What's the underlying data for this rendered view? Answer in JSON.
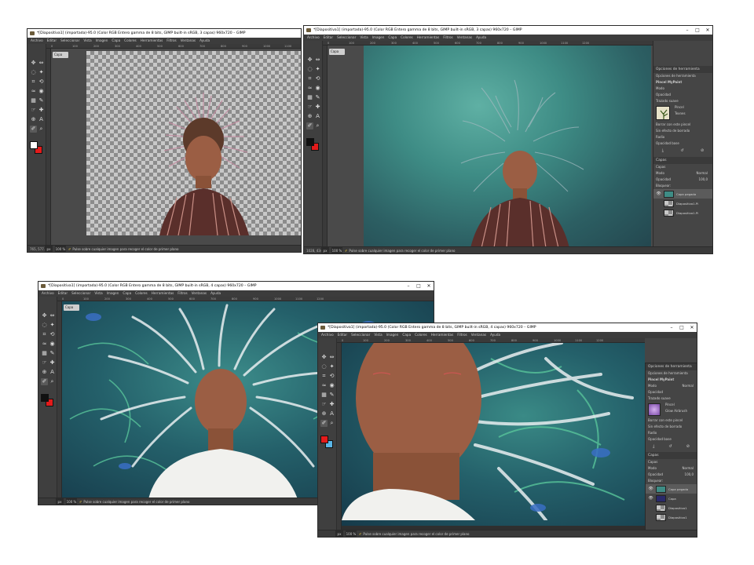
{
  "windows": [
    {
      "title": "*[Diapositiva1] (importada)-95.0 (Color RGB Entero gamma de 8 bits, GIMP built-in sRGB, 3 capas) 960x720 – GIMP",
      "status_coords": "765, 577.0",
      "layer_button": "Capa",
      "variant": "transparent",
      "has_controls": false
    },
    {
      "title": "*[Diapositiva1] (importada)-95.0 (Color RGB Entero gamma de 8 bits, GIMP built-in sRGB, 3 capas) 960x720 – GIMP",
      "status_coords": "1028, 434.0",
      "layer_button": "Capa",
      "variant": "teal-dark",
      "has_controls": true
    },
    {
      "title": "*[Diapositiva1] (importada)-95.0 (Color RGB Entero gamma de 8 bits, GIMP built-in sRGB, 4 capas) 960x720 – GIMP",
      "status_coords": "",
      "layer_button": "Capa",
      "variant": "painted",
      "has_controls": true
    },
    {
      "title": "*[Diapositiva1] (importada)-95.0 (Color RGB Entero gamma de 8 bits, GIMP built-in sRGB, 4 capas) 960x720 – GIMP",
      "status_coords": "",
      "layer_button": "",
      "variant": "zoomed",
      "has_controls": true
    }
  ],
  "menu": [
    "Archivo",
    "Editar",
    "Seleccionar",
    "Vista",
    "Imagen",
    "Capa",
    "Colores",
    "Herramientas",
    "Filtros",
    "Ventanas",
    "Ayuda"
  ],
  "statusbar": {
    "unit": "px",
    "zoom": "100 %",
    "message": "Pulse sobre cualquier imagen para recoger el color de primer plano"
  },
  "window_controls": {
    "minimize": "–",
    "maximize": "□",
    "close": "✕"
  },
  "ruler_ticks": [
    "0",
    "100",
    "200",
    "300",
    "400",
    "500",
    "600",
    "700",
    "800",
    "900",
    "1000",
    "1100",
    "1200"
  ],
  "tool_icons": [
    "move-icon",
    "align-icon",
    "lasso-icon",
    "fuzzy-select-icon",
    "crop-icon",
    "transform-icon",
    "warp-icon",
    "bucket-fill-icon",
    "gradient-icon",
    "paintbrush-icon",
    "smudge-icon",
    "heal-icon",
    "clone-icon",
    "text-icon",
    "color-picker-icon",
    "zoom-icon"
  ],
  "tool_glyphs": [
    "✥",
    "⇔",
    "◌",
    "✦",
    "⌗",
    "⟲",
    "≈",
    "◉",
    "▦",
    "✎",
    "☞",
    "✚",
    "⊕",
    "A",
    "✐",
    "⌕"
  ],
  "tool_options_b": {
    "header": "Opciones de herramienta",
    "tab": "Opciones de herramienta",
    "tool": "Pincel MyPaint",
    "mode_label": "Modo",
    "mode_value": "Normal",
    "opacity": "Opacidad",
    "smooth": "Trazado suave",
    "brush_label": "Pincel",
    "brush_name": "Texnes",
    "erase": "Borrar con este pincel",
    "no_erase": "Sin efecto de borrado",
    "radius": "Radio",
    "base_opacity": "Opacidad base"
  },
  "layers_b": {
    "header": "Capas",
    "tab": "Capas",
    "mode_label": "Modo",
    "mode_value": "Normal",
    "opacity_label": "Opacidad",
    "opacity_value": "100,0",
    "lock_label": "Bloquear:",
    "items": [
      "Capa pegada",
      "Diapositiva1.Pi",
      "Diapositiva1.Pi"
    ]
  },
  "tool_options_d": {
    "header": "Opciones de herramienta",
    "tab": "Opciones de herramienta",
    "tool": "Pincel MyPaint",
    "mode_label": "Modo",
    "mode_value": "Normal",
    "opacity": "Opacidad",
    "smooth": "Trazado suave",
    "brush_label": "Pincel",
    "brush_name": "Glow Airbrush",
    "erase": "Borrar con este pincel",
    "no_erase": "Sin efecto de borrado",
    "radius": "Radio",
    "base_opacity": "Opacidad base"
  },
  "layers_d": {
    "header": "Capas",
    "tab": "Capas",
    "mode_label": "Modo",
    "mode_value": "Normal",
    "opacity_label": "Opacidad",
    "opacity_value": "100,0",
    "lock_label": "Bloquear:",
    "items": [
      "Capa pegada",
      "Capa",
      "Diapositiva1",
      "Diapositiva1"
    ]
  },
  "colors": {
    "accent_red": "#e31b1b",
    "teal": "#3e8c85",
    "skin": "#9b5b3a",
    "ui_dark": "#454545"
  }
}
